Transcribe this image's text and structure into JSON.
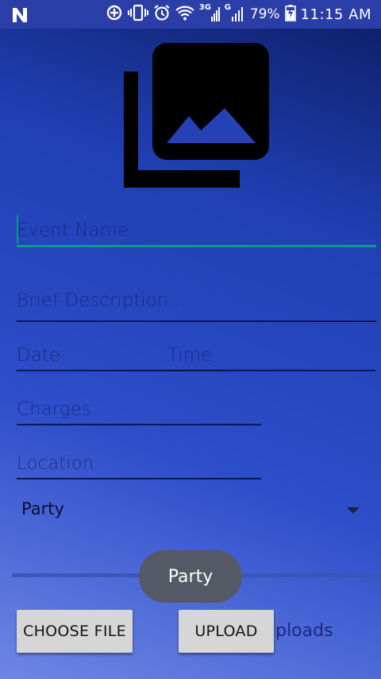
{
  "status_bar": {
    "battery_percent": "79%",
    "time": "11:15 AM",
    "network_label_1": "3G",
    "network_label_2": "G",
    "icons": [
      "n-icon",
      "data-saver-icon",
      "vibrate-icon",
      "alarm-icon",
      "wifi-icon",
      "signal-icon",
      "signal-icon",
      "battery-charging-icon"
    ]
  },
  "form": {
    "event_name_placeholder": "Event Name",
    "description_placeholder": "Brief Description...",
    "date_placeholder": "Date",
    "time_placeholder": "Time",
    "charges_placeholder": "Charges",
    "location_placeholder": "Location",
    "category_selected": "Party"
  },
  "toast": {
    "text": "Party"
  },
  "buttons": {
    "choose_file": "CHOOSE FILE",
    "upload": "UPLOAD"
  },
  "uploads_text": "Uploads",
  "colors": {
    "status_bar": "#2b3ea8",
    "accent": "#12968c",
    "button_bg": "#d6d6d6",
    "toast_bg": "#555966"
  }
}
